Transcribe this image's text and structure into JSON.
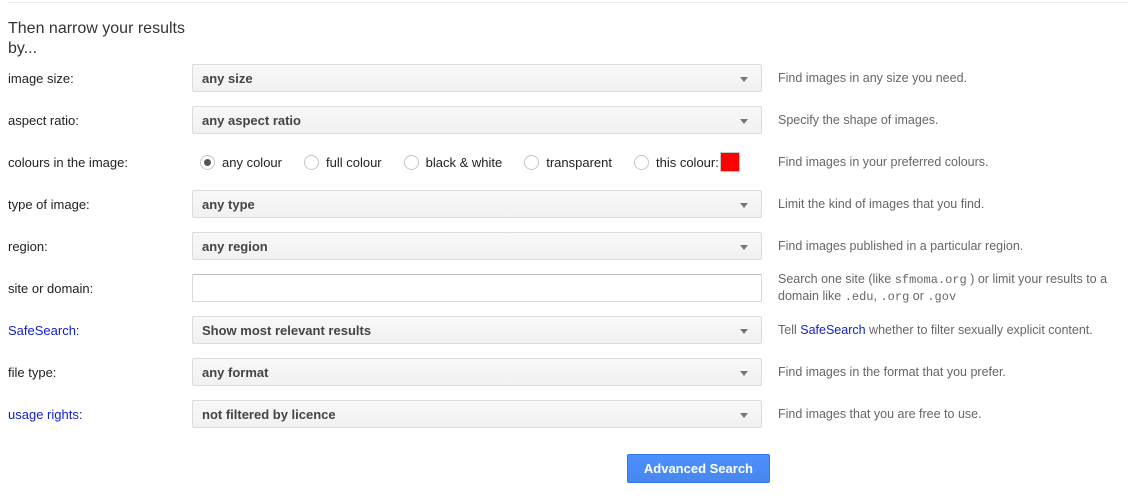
{
  "page": {
    "heading": "Then narrow your results by..."
  },
  "colors": {
    "link_blue": "#1122cc",
    "button_blue": "#4d90fe",
    "swatch_red": "#ff0000",
    "help_gray": "#666666"
  },
  "rows": {
    "image_size": {
      "label": "image size:",
      "value": "any size",
      "help": "Find images in any size you need."
    },
    "aspect_ratio": {
      "label": "aspect ratio:",
      "value": "any aspect ratio",
      "help": "Specify the shape of images."
    },
    "colours": {
      "label": "colours in the image:",
      "options": [
        {
          "label": "any colour",
          "selected": true
        },
        {
          "label": "full colour",
          "selected": false
        },
        {
          "label": "black & white",
          "selected": false
        },
        {
          "label": "transparent",
          "selected": false
        },
        {
          "label": "this colour:",
          "selected": false
        }
      ],
      "swatch_color": "#ff0000",
      "help": "Find images in your preferred colours."
    },
    "type_of_image": {
      "label": "type of image:",
      "value": "any type",
      "help": "Limit the kind of images that you find."
    },
    "region": {
      "label": "region:",
      "value": "any region",
      "help": "Find images published in a particular region."
    },
    "site_or_domain": {
      "label": "site or domain:",
      "value": "",
      "help_parts": {
        "t1": "Search one site (like ",
        "m1": "sfmoma.org",
        "t2": " ) or limit your results to a domain like ",
        "m2": ".edu",
        "t3": ", ",
        "m3": ".org",
        "t4": " or ",
        "m4": ".gov"
      }
    },
    "safesearch": {
      "label": "SafeSearch:",
      "value": "Show most relevant results",
      "help_pre": "Tell ",
      "help_link": "SafeSearch",
      "help_post": " whether to filter sexually explicit content."
    },
    "file_type": {
      "label": "file type:",
      "value": "any format",
      "help": "Find images in the format that you prefer."
    },
    "usage_rights": {
      "label": "usage rights:",
      "value": "not filtered by licence",
      "help": "Find images that you are free to use."
    }
  },
  "button": {
    "label": "Advanced Search"
  }
}
